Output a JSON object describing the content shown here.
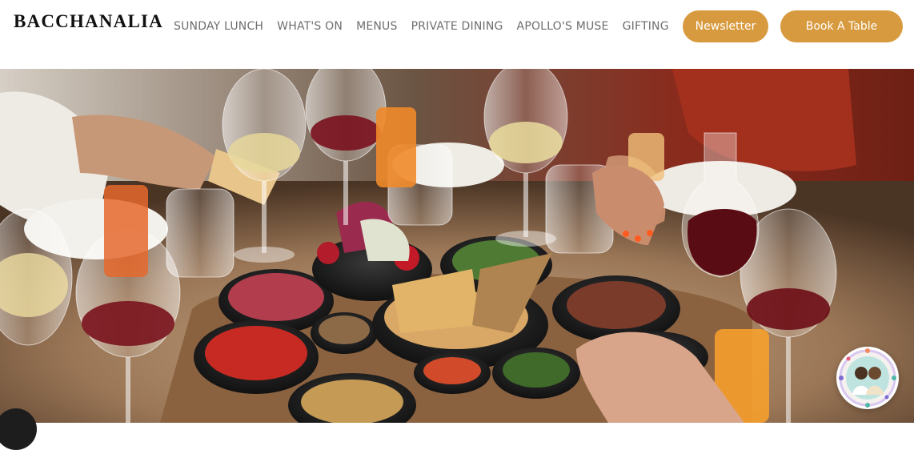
{
  "brand": {
    "logo_text": "BACCHANALIA",
    "accent_color": "#d89a3e"
  },
  "nav": {
    "items": [
      {
        "label": "SUNDAY LUNCH"
      },
      {
        "label": "WHAT'S ON"
      },
      {
        "label": "MENUS"
      },
      {
        "label": "PRIVATE DINING"
      },
      {
        "label": "APOLLO'S MUSE"
      },
      {
        "label": "GIFTING"
      }
    ]
  },
  "buttons": {
    "newsletter_label": "Newsletter",
    "book_label": "Book A Table"
  },
  "hero": {
    "image_description_icon": "dining-table-photo"
  },
  "widgets": {
    "chat_icon": "chat-avatar-icon",
    "corner_icon": "scroll-button-icon"
  }
}
